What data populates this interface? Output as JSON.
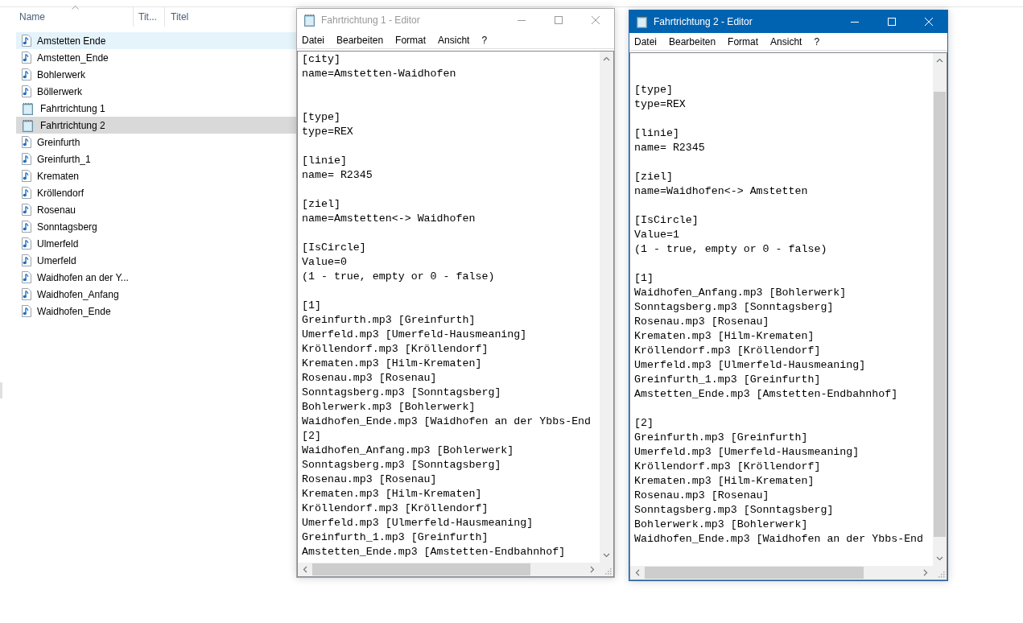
{
  "explorer": {
    "columns": [
      {
        "label": "Name",
        "sorted": true
      },
      {
        "label": "Tit...",
        "sorted": false
      },
      {
        "label": "Titel",
        "sorted": false
      }
    ],
    "files": [
      {
        "name": "Amstetten Ende",
        "kind": "audio",
        "selected": false,
        "hovered": true
      },
      {
        "name": "Amstetten_Ende",
        "kind": "audio",
        "selected": false,
        "hovered": false
      },
      {
        "name": "Bohlerwerk",
        "kind": "audio",
        "selected": false,
        "hovered": false
      },
      {
        "name": "Böllerwerk",
        "kind": "audio",
        "selected": false,
        "hovered": false
      },
      {
        "name": "Fahrtrichtung 1",
        "kind": "text",
        "selected": false,
        "hovered": false
      },
      {
        "name": "Fahrtrichtung 2",
        "kind": "text",
        "selected": true,
        "hovered": false
      },
      {
        "name": "Greinfurth",
        "kind": "audio",
        "selected": false,
        "hovered": false
      },
      {
        "name": "Greinfurth_1",
        "kind": "audio",
        "selected": false,
        "hovered": false
      },
      {
        "name": "Krematen",
        "kind": "audio",
        "selected": false,
        "hovered": false
      },
      {
        "name": "Kröllendorf",
        "kind": "audio",
        "selected": false,
        "hovered": false
      },
      {
        "name": "Rosenau",
        "kind": "audio",
        "selected": false,
        "hovered": false
      },
      {
        "name": "Sonntagsberg",
        "kind": "audio",
        "selected": false,
        "hovered": false
      },
      {
        "name": "Ulmerfeld",
        "kind": "audio",
        "selected": false,
        "hovered": false
      },
      {
        "name": "Umerfeld",
        "kind": "audio",
        "selected": false,
        "hovered": false
      },
      {
        "name": "Waidhofen an der Y...",
        "kind": "audio",
        "selected": false,
        "hovered": false
      },
      {
        "name": "Waidhofen_Anfang",
        "kind": "audio",
        "selected": false,
        "hovered": false
      },
      {
        "name": "Waidhofen_Ende",
        "kind": "audio",
        "selected": false,
        "hovered": false
      }
    ]
  },
  "editors": [
    {
      "title": "Fahrtrichtung 1 - Editor",
      "active": false,
      "menu": [
        "Datei",
        "Bearbeiten",
        "Format",
        "Ansicht",
        "?"
      ],
      "vertical_scroll_thumb": false,
      "text": "[city]\nname=Amstetten-Waidhofen\n\n\n[type]\ntype=REX\n\n[linie]\nname= R2345\n\n[ziel]\nname=Amstetten<-> Waidhofen\n\n[IsCircle]\nValue=0\n(1 - true, empty or 0 - false)\n\n[1]\nGreinfurth.mp3 [Greinfurth]\nUmerfeld.mp3 [Umerfeld-Hausmeaning]\nKröllendorf.mp3 [Kröllendorf]\nKrematen.mp3 [Hilm-Krematen]\nRosenau.mp3 [Rosenau]\nSonntagsberg.mp3 [Sonntagsberg]\nBohlerwerk.mp3 [Bohlerwerk]\nWaidhofen_Ende.mp3 [Waidhofen an der Ybbs-End\n[2]\nWaidhofen_Anfang.mp3 [Bohlerwerk]\nSonntagsberg.mp3 [Sonntagsberg]\nRosenau.mp3 [Rosenau]\nKrematen.mp3 [Hilm-Krematen]\nKröllendorf.mp3 [Kröllendorf]\nUmerfeld.mp3 [Ulmerfeld-Hausmeaning]\nGreinfurth_1.mp3 [Greinfurth]\nAmstetten_Ende.mp3 [Amstetten-Endbahnhof]"
    },
    {
      "title": "Fahrtrichtung 2 - Editor",
      "active": true,
      "menu": [
        "Datei",
        "Bearbeiten",
        "Format",
        "Ansicht",
        "?"
      ],
      "vertical_scroll_thumb": true,
      "text": "\n\n[type]\ntype=REX\n\n[linie]\nname= R2345\n\n[ziel]\nname=Waidhofen<-> Amstetten\n\n[IsCircle]\nValue=1\n(1 - true, empty or 0 - false)\n\n[1]\nWaidhofen_Anfang.mp3 [Bohlerwerk]\nSonntagsberg.mp3 [Sonntagsberg]\nRosenau.mp3 [Rosenau]\nKrematen.mp3 [Hilm-Krematen]\nKröllendorf.mp3 [Kröllendorf]\nUmerfeld.mp3 [Ulmerfeld-Hausmeaning]\nGreinfurth_1.mp3 [Greinfurth]\nAmstetten_Ende.mp3 [Amstetten-Endbahnhof]\n\n[2]\nGreinfurth.mp3 [Greinfurth]\nUmerfeld.mp3 [Umerfeld-Hausmeaning]\nKröllendorf.mp3 [Kröllendorf]\nKrematen.mp3 [Hilm-Krematen]\nRosenau.mp3 [Rosenau]\nSonntagsberg.mp3 [Sonntagsberg]\nBohlerwerk.mp3 [Bohlerwerk]\nWaidhofen_Ende.mp3 [Waidhofen an der Ybbs-End"
    }
  ]
}
